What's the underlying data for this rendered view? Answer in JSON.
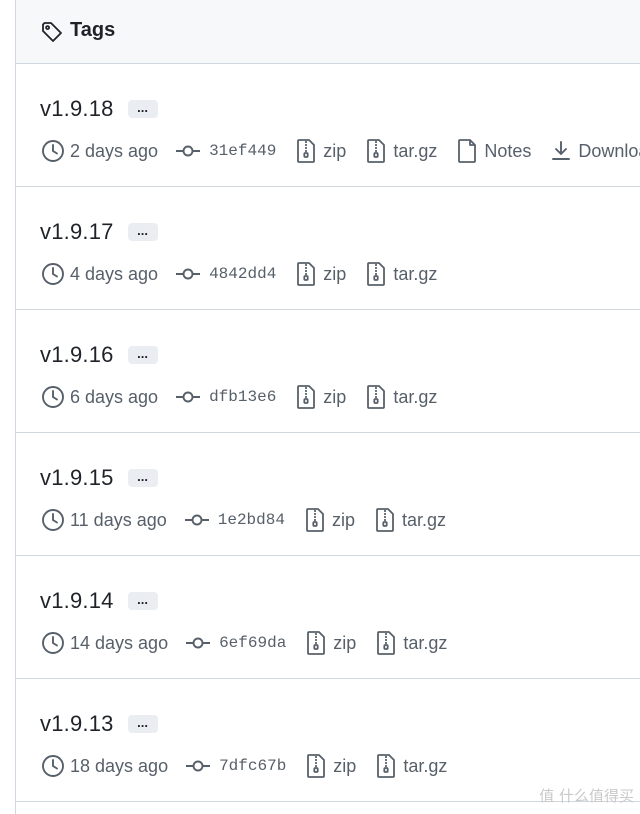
{
  "header": {
    "title": "Tags",
    "icon": "tag-icon"
  },
  "ellipsis_label": "...",
  "tags": [
    {
      "name": "v1.9.18",
      "age": "2 days ago",
      "sha": "31ef449",
      "zip": "zip",
      "targz": "tar.gz",
      "notes": "Notes",
      "downloads": "Downloads"
    },
    {
      "name": "v1.9.17",
      "age": "4 days ago",
      "sha": "4842dd4",
      "zip": "zip",
      "targz": "tar.gz"
    },
    {
      "name": "v1.9.16",
      "age": "6 days ago",
      "sha": "dfb13e6",
      "zip": "zip",
      "targz": "tar.gz"
    },
    {
      "name": "v1.9.15",
      "age": "11 days ago",
      "sha": "1e2bd84",
      "zip": "zip",
      "targz": "tar.gz"
    },
    {
      "name": "v1.9.14",
      "age": "14 days ago",
      "sha": "6ef69da",
      "zip": "zip",
      "targz": "tar.gz"
    },
    {
      "name": "v1.9.13",
      "age": "18 days ago",
      "sha": "7dfc67b",
      "zip": "zip",
      "targz": "tar.gz"
    }
  ],
  "watermark": "值 什么值得买",
  "colors": {
    "text": "#1f2328",
    "muted": "#57606a",
    "border": "#d0d7de",
    "header_bg": "#f6f8fa",
    "button_bg": "#eaeef2"
  }
}
